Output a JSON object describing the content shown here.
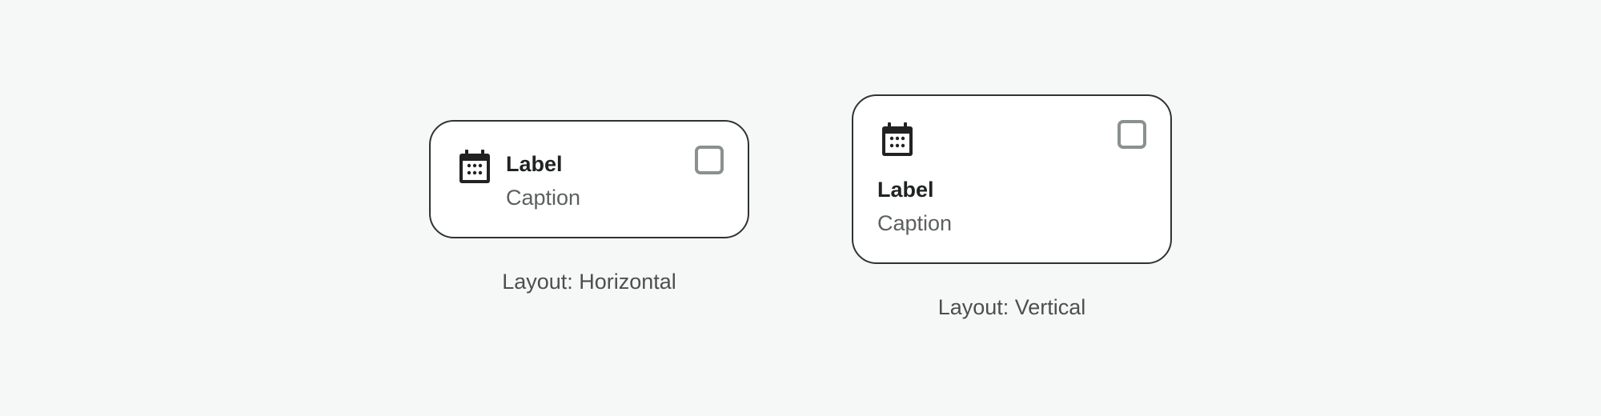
{
  "horizontal_card": {
    "label": "Label",
    "caption": "Caption",
    "icon": "calendar-icon",
    "checked": false
  },
  "vertical_card": {
    "label": "Label",
    "caption": "Caption",
    "icon": "calendar-icon",
    "checked": false
  },
  "captions": {
    "horizontal": "Layout: Horizontal",
    "vertical": "Layout: Vertical"
  },
  "colors": {
    "background": "#f6f8f7",
    "card_border": "#2f3331",
    "icon": "#222222",
    "checkbox_border": "#8a918e",
    "label_text": "#1f2321",
    "caption_text": "#5b615e"
  }
}
